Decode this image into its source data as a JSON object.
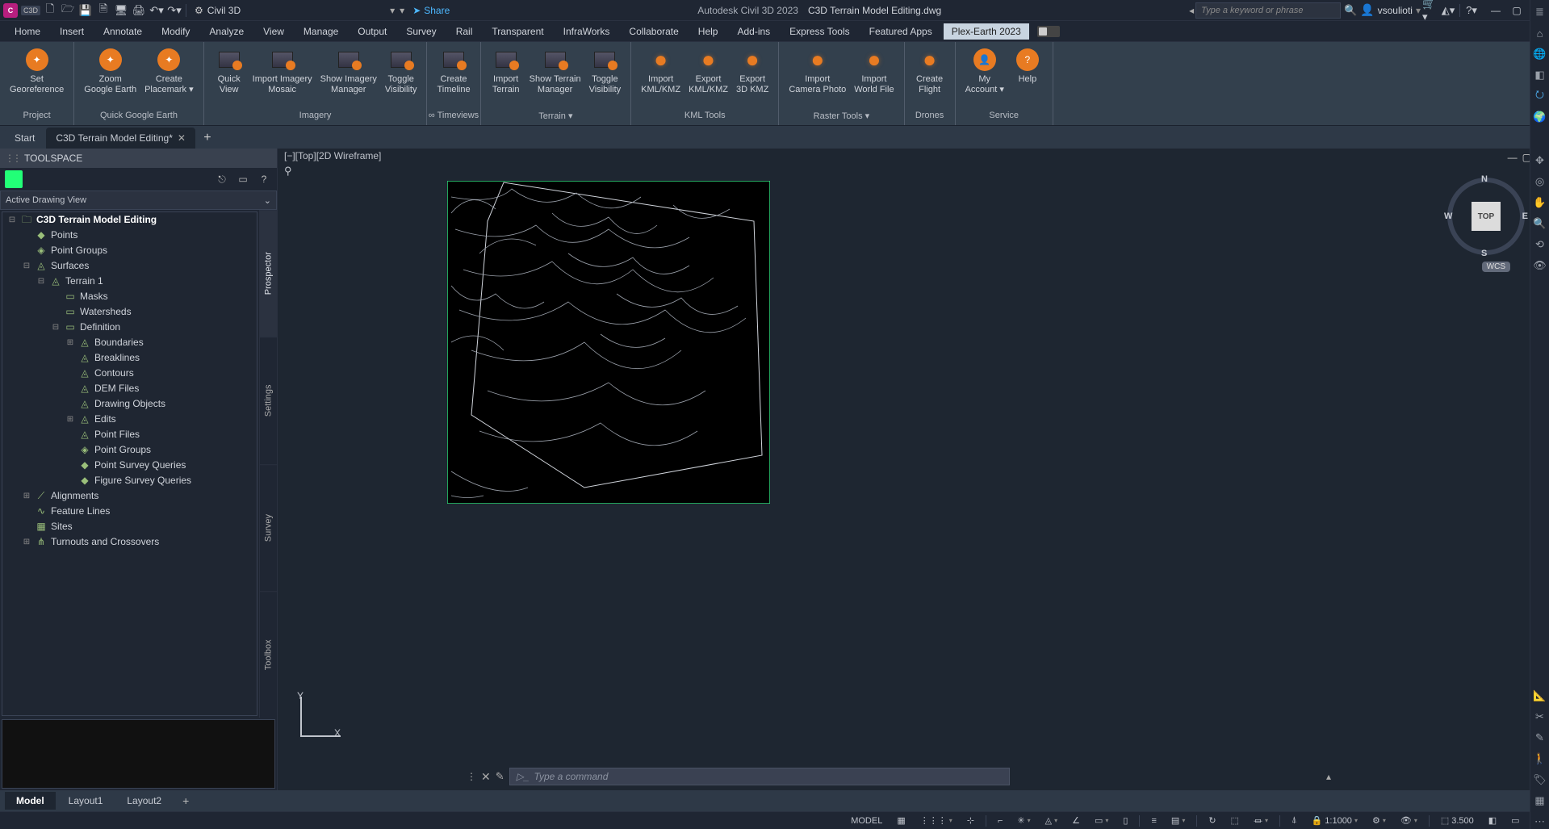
{
  "app": {
    "name": "Autodesk Civil 3D 2023",
    "document": "C3D Terrain Model Editing.dwg",
    "workspace": "Civil 3D"
  },
  "titlebar": {
    "c3d": "C",
    "c3d_tag": "C3D",
    "share": "Share",
    "search_placeholder": "Type a keyword or phrase",
    "username": "vsoulioti",
    "dropdown_glyph": "▾"
  },
  "menubar": [
    "Home",
    "Insert",
    "Annotate",
    "Modify",
    "Analyze",
    "View",
    "Manage",
    "Output",
    "Survey",
    "Rail",
    "Transparent",
    "InfraWorks",
    "Collaborate",
    "Help",
    "Add-ins",
    "Express Tools",
    "Featured Apps",
    "Plex-Earth 2023"
  ],
  "ribbon_panels": [
    {
      "label": "Project",
      "items": [
        {
          "l": "Set\nGeoreference"
        }
      ]
    },
    {
      "label": "Quick Google Earth",
      "items": [
        {
          "l": "Zoom\nGoogle Earth"
        },
        {
          "l": "Create\nPlacemark",
          "dd": true
        }
      ]
    },
    {
      "label": "Imagery",
      "items": [
        {
          "l": "Quick\nView"
        },
        {
          "l": "Import Imagery\nMosaic"
        },
        {
          "l": "Show Imagery\nManager"
        },
        {
          "l": "Toggle\nVisibility"
        }
      ]
    },
    {
      "label": "∞ Timeviews",
      "items": [
        {
          "l": "Create\nTimeline"
        }
      ],
      "dd": true
    },
    {
      "label": "Terrain ▾",
      "items": [
        {
          "l": "Import\nTerrain"
        },
        {
          "l": "Show Terrain\nManager"
        },
        {
          "l": "Toggle\nVisibility"
        }
      ]
    },
    {
      "label": "KML Tools",
      "items": [
        {
          "l": "Import\nKML/KMZ"
        },
        {
          "l": "Export\nKML/KMZ"
        },
        {
          "l": "Export\n3D KMZ"
        }
      ]
    },
    {
      "label": "Raster Tools ▾",
      "items": [
        {
          "l": "Import\nCamera Photo"
        },
        {
          "l": "Import\nWorld File"
        }
      ]
    },
    {
      "label": "Drones",
      "items": [
        {
          "l": "Create\nFlight"
        }
      ]
    },
    {
      "label": "Service",
      "items": [
        {
          "l": "My\nAccount",
          "dd": true
        },
        {
          "l": "Help"
        }
      ]
    }
  ],
  "filetabs": {
    "tabs": [
      {
        "label": "Start"
      },
      {
        "label": "C3D Terrain Model Editing*",
        "close": true,
        "active": true
      }
    ],
    "plus": "+"
  },
  "toolspace": {
    "title": "TOOLSPACE",
    "adv": "Active Drawing View",
    "sidetabs": [
      "Prospector",
      "Settings",
      "Survey",
      "Toolbox"
    ],
    "tree": [
      {
        "d": 0,
        "t": "⊟",
        "i": "🗀",
        "l": "C3D Terrain Model Editing",
        "bold": true
      },
      {
        "d": 1,
        "t": "",
        "i": "◆",
        "l": "Points"
      },
      {
        "d": 1,
        "t": "",
        "i": "◈",
        "l": "Point Groups"
      },
      {
        "d": 1,
        "t": "⊟",
        "i": "◬",
        "l": "Surfaces"
      },
      {
        "d": 2,
        "t": "⊟",
        "i": "◬",
        "l": "Terrain 1"
      },
      {
        "d": 3,
        "t": "",
        "i": "▭",
        "l": "Masks"
      },
      {
        "d": 3,
        "t": "",
        "i": "▭",
        "l": "Watersheds"
      },
      {
        "d": 3,
        "t": "⊟",
        "i": "▭",
        "l": "Definition"
      },
      {
        "d": 4,
        "t": "⊞",
        "i": "◬",
        "l": "Boundaries"
      },
      {
        "d": 4,
        "t": "",
        "i": "◬",
        "l": "Breaklines"
      },
      {
        "d": 4,
        "t": "",
        "i": "◬",
        "l": "Contours"
      },
      {
        "d": 4,
        "t": "",
        "i": "◬",
        "l": "DEM Files"
      },
      {
        "d": 4,
        "t": "",
        "i": "◬",
        "l": "Drawing Objects"
      },
      {
        "d": 4,
        "t": "⊞",
        "i": "◬",
        "l": "Edits"
      },
      {
        "d": 4,
        "t": "",
        "i": "◬",
        "l": "Point Files"
      },
      {
        "d": 4,
        "t": "",
        "i": "◈",
        "l": "Point Groups"
      },
      {
        "d": 4,
        "t": "",
        "i": "◆",
        "l": "Point Survey Queries"
      },
      {
        "d": 4,
        "t": "",
        "i": "◆",
        "l": "Figure Survey Queries"
      },
      {
        "d": 1,
        "t": "⊞",
        "i": "⟋",
        "l": "Alignments"
      },
      {
        "d": 1,
        "t": "",
        "i": "∿",
        "l": "Feature Lines"
      },
      {
        "d": 1,
        "t": "",
        "i": "▦",
        "l": "Sites"
      },
      {
        "d": 1,
        "t": "⊞",
        "i": "⋔",
        "l": "Turnouts and Crossovers"
      }
    ]
  },
  "canvas": {
    "label": "[−][Top][2D Wireframe]",
    "wcs": "WCS",
    "cube": "TOP",
    "dirs": {
      "n": "N",
      "e": "E",
      "s": "S",
      "w": "W"
    },
    "y": "Y",
    "x": "X"
  },
  "cmd": {
    "placeholder": "Type a command"
  },
  "layouttabs": [
    "Model",
    "Layout1",
    "Layout2"
  ],
  "status": {
    "model": "MODEL",
    "scale": "1:1000",
    "decimal": "3.500"
  }
}
